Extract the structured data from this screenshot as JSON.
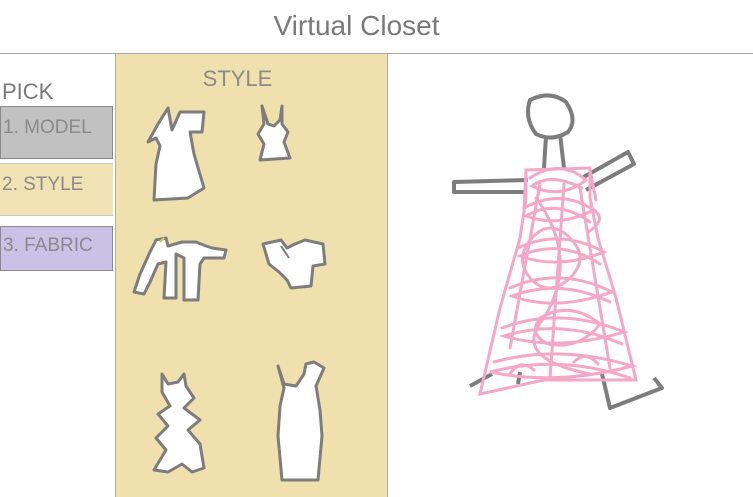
{
  "app": {
    "title": "Virtual Closet"
  },
  "sidebar": {
    "heading": "PICK",
    "steps": [
      {
        "label": "1. MODEL"
      },
      {
        "label": "2. STYLE"
      },
      {
        "label": "3. FABRIC"
      }
    ]
  },
  "style_panel": {
    "heading": "STYLE",
    "items": [
      {
        "icon": "mini-dress-icon"
      },
      {
        "icon": "tank-top-icon"
      },
      {
        "icon": "long-sleeve-jacket-icon"
      },
      {
        "icon": "short-sleeve-top-icon"
      },
      {
        "icon": "ruffle-dress-icon"
      },
      {
        "icon": "long-dress-icon"
      }
    ]
  },
  "preview": {
    "dress_color": "#f5a7c8",
    "outline_color": "#7d7d7d"
  }
}
